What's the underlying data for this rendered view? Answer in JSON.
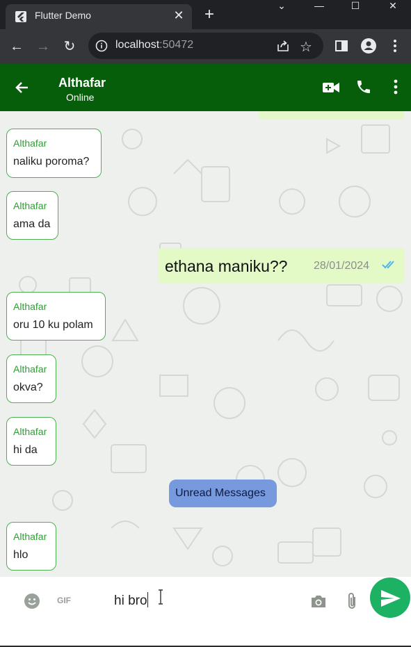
{
  "browser": {
    "tab_title": "Flutter Demo",
    "tab_close_icon": "close-icon",
    "new_tab_icon": "plus-icon",
    "url_host": "localhost",
    "url_port": ":50472"
  },
  "app_bar": {
    "contact_name": "Althafar",
    "contact_status": "Online"
  },
  "messages": {
    "m1": {
      "sender": "Althafar",
      "text": "naliku poroma?"
    },
    "m2": {
      "sender": "Althafar",
      "text": "ama da"
    },
    "m3": {
      "text": "ethana maniku??",
      "time": "28/01/2024"
    },
    "m4": {
      "sender": "Althafar",
      "text": "oru 10 ku polam"
    },
    "m5": {
      "sender": "Althafar",
      "text": "okva?"
    },
    "m6": {
      "sender": "Althafar",
      "text": "hi da"
    },
    "unread_label": "Unread Messages",
    "m7": {
      "sender": "Althafar",
      "text": "hlo"
    }
  },
  "input": {
    "gif_label": "GIF",
    "value": "hi bro"
  },
  "colors": {
    "app_bar": "#075e0a",
    "incoming_border": "#4caf50",
    "outgoing_bg": "#e3f9c6",
    "unread_bg": "#7799dd",
    "send_button": "#1db163"
  }
}
